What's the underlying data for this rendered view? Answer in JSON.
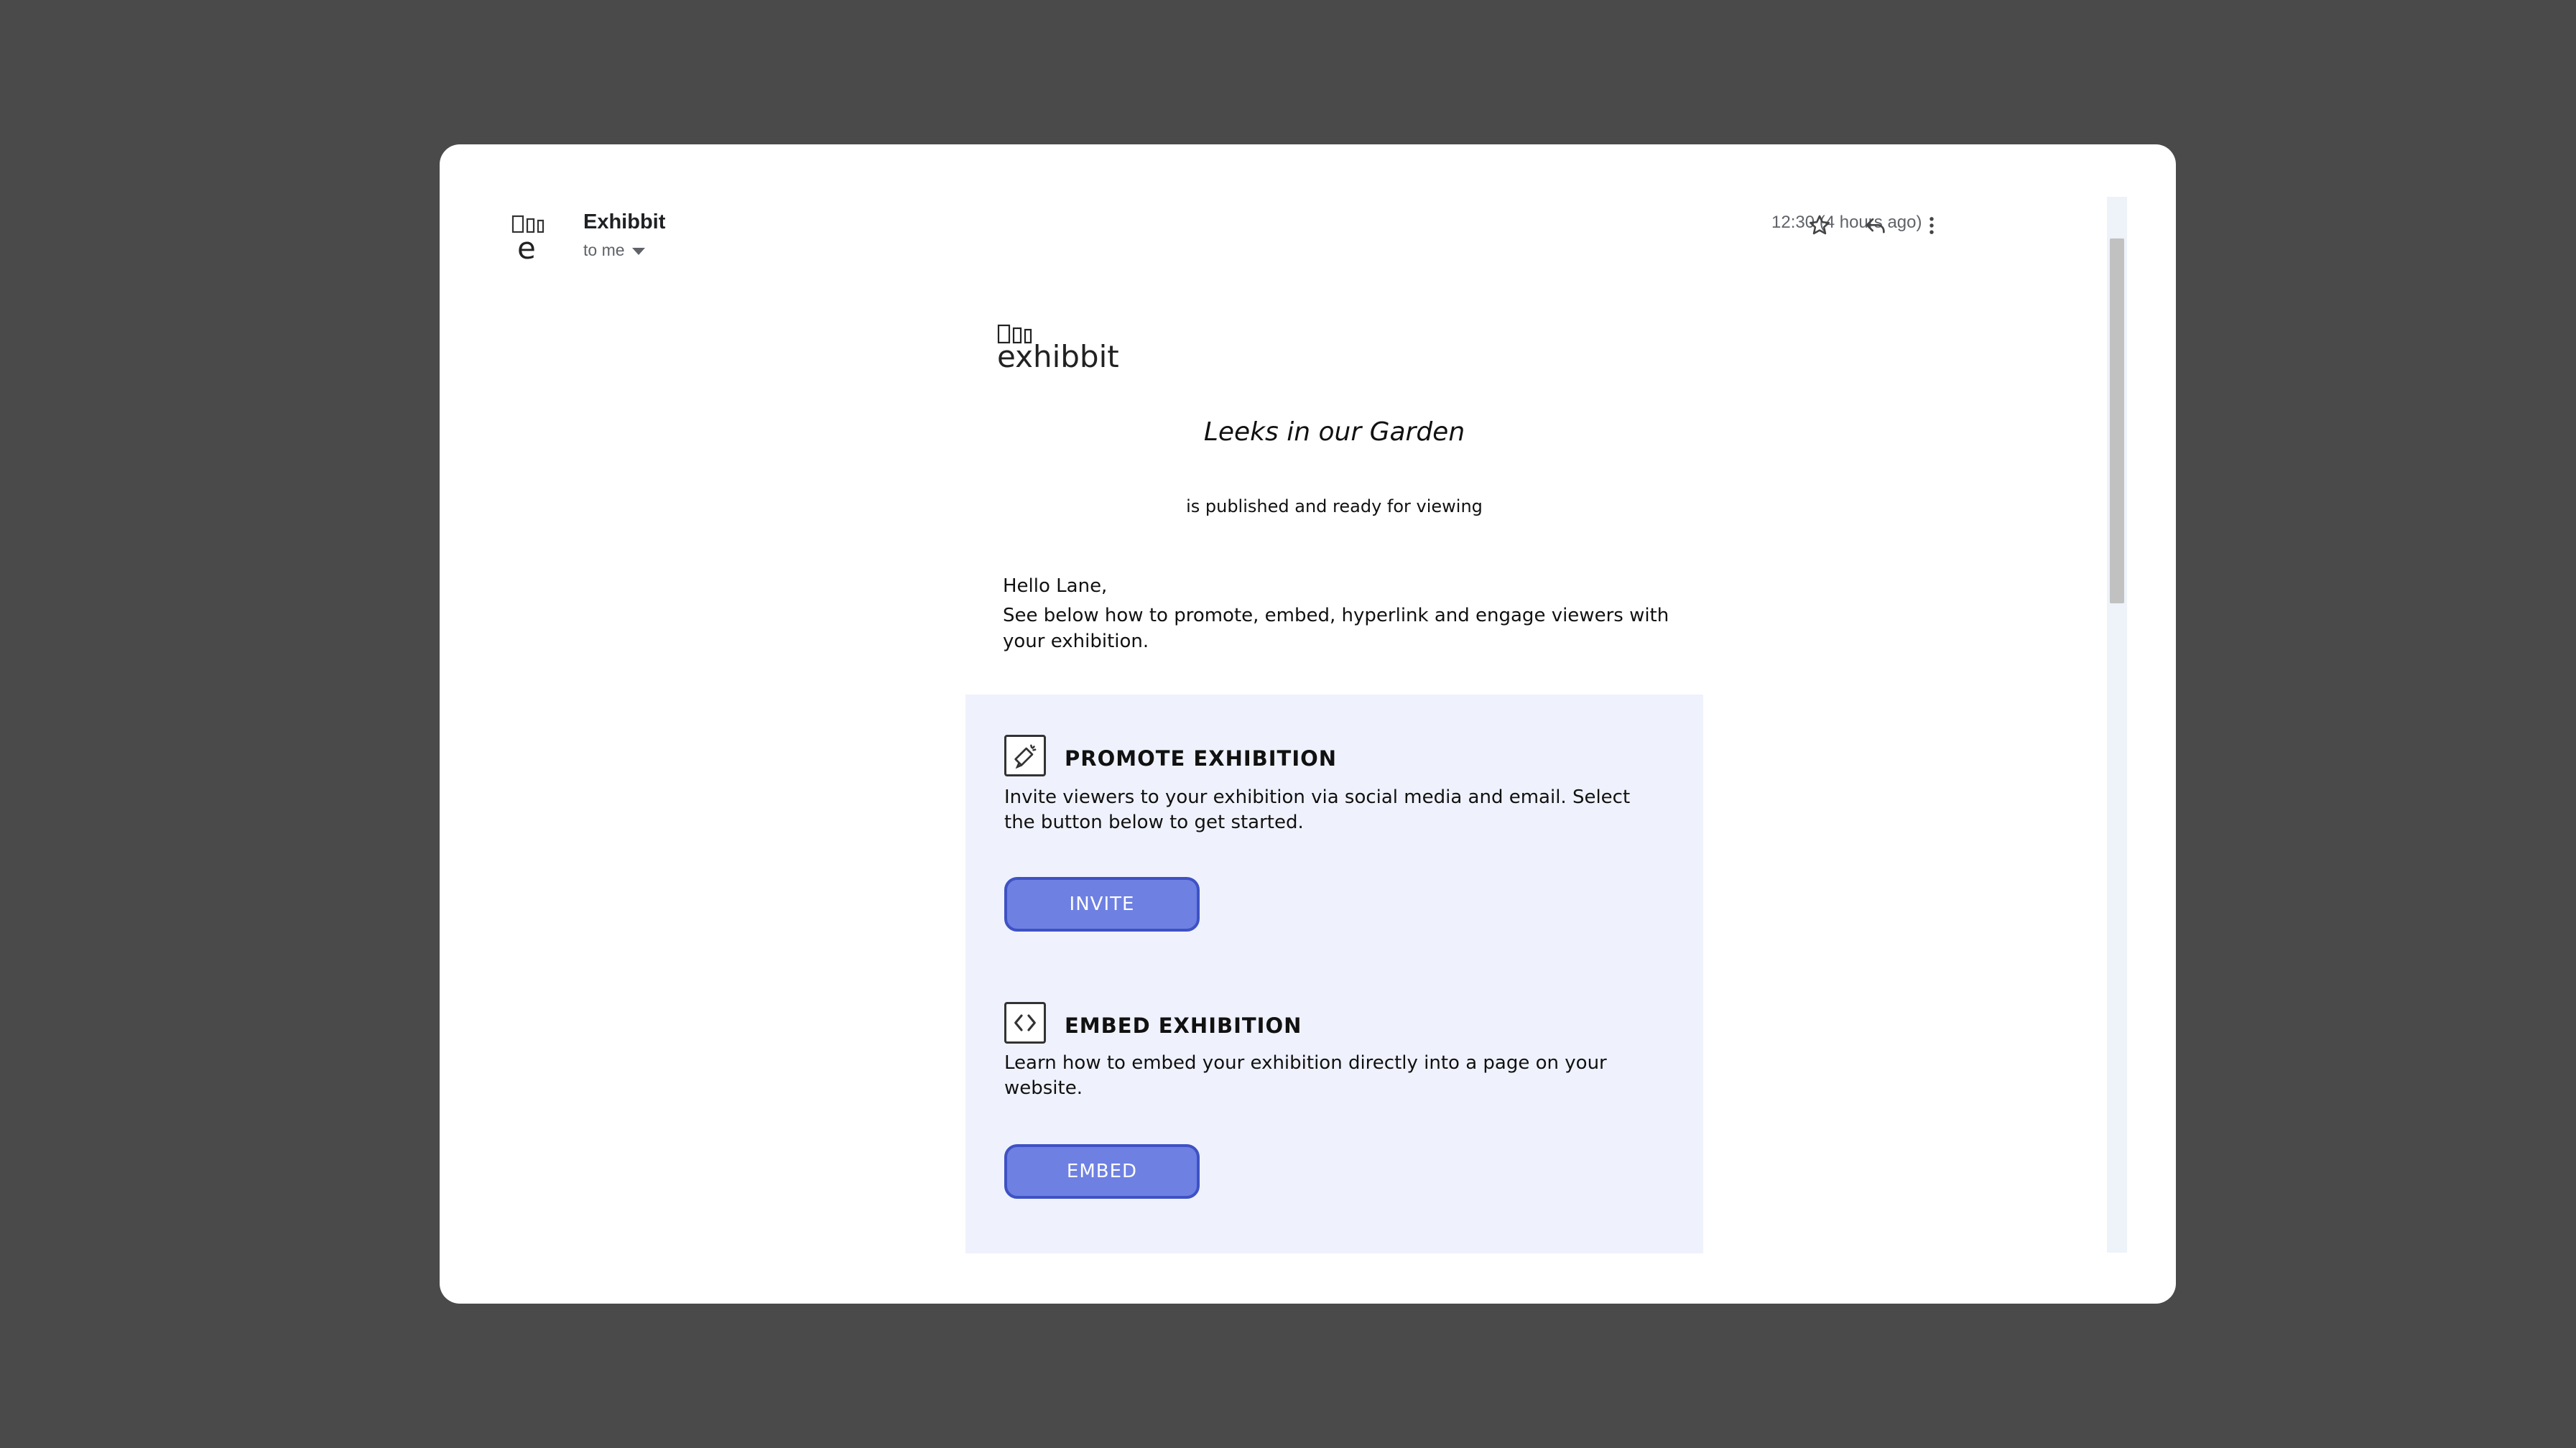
{
  "header": {
    "sender_name": "Exhibbit",
    "recipient_label": "to me",
    "timestamp": "12:30 (4 hours ago)"
  },
  "icons": {
    "star": "star-icon",
    "reply": "reply-icon",
    "more": "more-vert-icon",
    "promote": "megaphone-icon",
    "embed": "code-icon"
  },
  "colors": {
    "background": "#4a4a4a",
    "panel": "#eff2fc",
    "button_fill": "#6e80e2",
    "button_border": "#3e52c4"
  },
  "email": {
    "brand_logo_text": "exhibbit",
    "exhibition_title": "Leeks in our Garden",
    "subtitle": "is published and ready for viewing",
    "greeting": "Hello Lane,",
    "intro": "See below how to promote, embed, hyperlink and engage viewers with your exhibition.",
    "sections": [
      {
        "title": "PROMOTE EXHIBITION",
        "description": "Invite viewers to your exhibition via social media and email. Select the button below to get started.",
        "button_label": "INVITE"
      },
      {
        "title": "EMBED EXHIBITION",
        "description": "Learn how to embed your exhibition directly into a page on your website.",
        "button_label": "EMBED"
      }
    ]
  }
}
